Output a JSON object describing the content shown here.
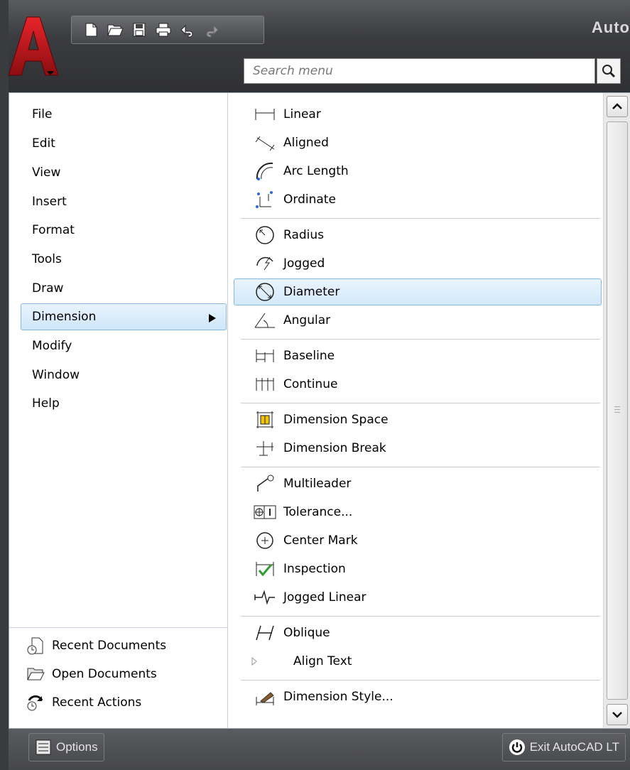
{
  "app_title": "Auto",
  "quick_access": [
    {
      "name": "new-icon"
    },
    {
      "name": "open-icon"
    },
    {
      "name": "save-icon"
    },
    {
      "name": "print-icon"
    },
    {
      "name": "undo-icon"
    },
    {
      "name": "redo-icon"
    }
  ],
  "search": {
    "placeholder": "Search menu"
  },
  "main_menu": [
    {
      "label": "File"
    },
    {
      "label": "Edit"
    },
    {
      "label": "View"
    },
    {
      "label": "Insert"
    },
    {
      "label": "Format"
    },
    {
      "label": "Tools"
    },
    {
      "label": "Draw"
    },
    {
      "label": "Dimension",
      "active": true
    },
    {
      "label": "Modify"
    },
    {
      "label": "Window"
    },
    {
      "label": "Help"
    }
  ],
  "bottom_menu": [
    {
      "label": "Recent Documents",
      "icon": "recent-documents-icon"
    },
    {
      "label": "Open Documents",
      "icon": "open-documents-icon"
    },
    {
      "label": "Recent Actions",
      "icon": "recent-actions-icon"
    }
  ],
  "submenu": [
    {
      "label": "Linear",
      "icon": "linear-dimension-icon"
    },
    {
      "label": "Aligned",
      "icon": "aligned-dimension-icon"
    },
    {
      "label": "Arc Length",
      "icon": "arc-length-icon"
    },
    {
      "label": "Ordinate",
      "icon": "ordinate-icon"
    },
    {
      "label": "Radius",
      "icon": "radius-icon"
    },
    {
      "label": "Jogged",
      "icon": "jogged-icon"
    },
    {
      "label": "Diameter",
      "icon": "diameter-icon",
      "active": true
    },
    {
      "label": "Angular",
      "icon": "angular-icon"
    },
    {
      "label": "Baseline",
      "icon": "baseline-icon"
    },
    {
      "label": "Continue",
      "icon": "continue-icon"
    },
    {
      "label": "Dimension Space",
      "icon": "dimension-space-icon"
    },
    {
      "label": "Dimension Break",
      "icon": "dimension-break-icon"
    },
    {
      "label": "Multileader",
      "icon": "multileader-icon"
    },
    {
      "label": "Tolerance...",
      "icon": "tolerance-icon"
    },
    {
      "label": "Center Mark",
      "icon": "center-mark-icon"
    },
    {
      "label": "Inspection",
      "icon": "inspection-icon"
    },
    {
      "label": "Jogged Linear",
      "icon": "jogged-linear-icon"
    },
    {
      "label": "Oblique",
      "icon": "oblique-icon"
    },
    {
      "label": "Align Text",
      "icon": "submenu-arrow-icon"
    },
    {
      "label": "Dimension Style...",
      "icon": "dimension-style-icon"
    }
  ],
  "footer": {
    "options_label": "Options",
    "exit_label": "Exit AutoCAD LT"
  }
}
